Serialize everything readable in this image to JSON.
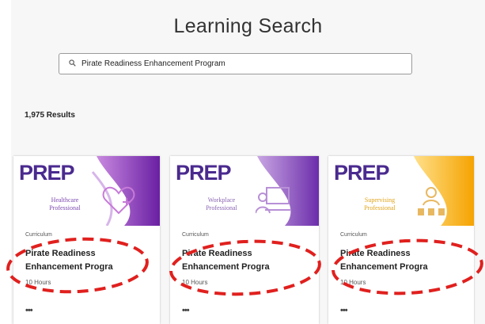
{
  "header": {
    "title": "Learning Search"
  },
  "search": {
    "value": "Pirate Readiness Enhancement Program"
  },
  "results": {
    "count_label": "1,975 Results"
  },
  "cards": [
    {
      "logo": "PREP",
      "subtitle_line1": "Healthcare",
      "subtitle_line2": "Professional",
      "type": "Curriculum",
      "title_line1": "Pirate Readiness",
      "title_line2": "Enhancement Progra",
      "duration": "10 Hours",
      "more": "•••"
    },
    {
      "logo": "PREP",
      "subtitle_line1": "Workplace",
      "subtitle_line2": "Professional",
      "type": "Curriculum",
      "title_line1": "Pirate Readiness",
      "title_line2": "Enhancement Progra",
      "duration": "10 Hours",
      "more": "•••"
    },
    {
      "logo": "PREP",
      "subtitle_line1": "Supervising",
      "subtitle_line2": "Professional",
      "type": "Curriculum",
      "title_line1": "Pirate Readiness",
      "title_line2": "Enhancement Progra",
      "duration": "10 Hours",
      "more": "•••"
    }
  ],
  "colors": {
    "brand_purple": "#4a2a8f",
    "card1_accent": "#8d2fb5",
    "card2_accent": "#7a3fb0",
    "card3_accent": "#f5b21c",
    "annotation_red": "#e0201e"
  },
  "icons": {
    "search": "search-icon",
    "more": "more-icon"
  }
}
